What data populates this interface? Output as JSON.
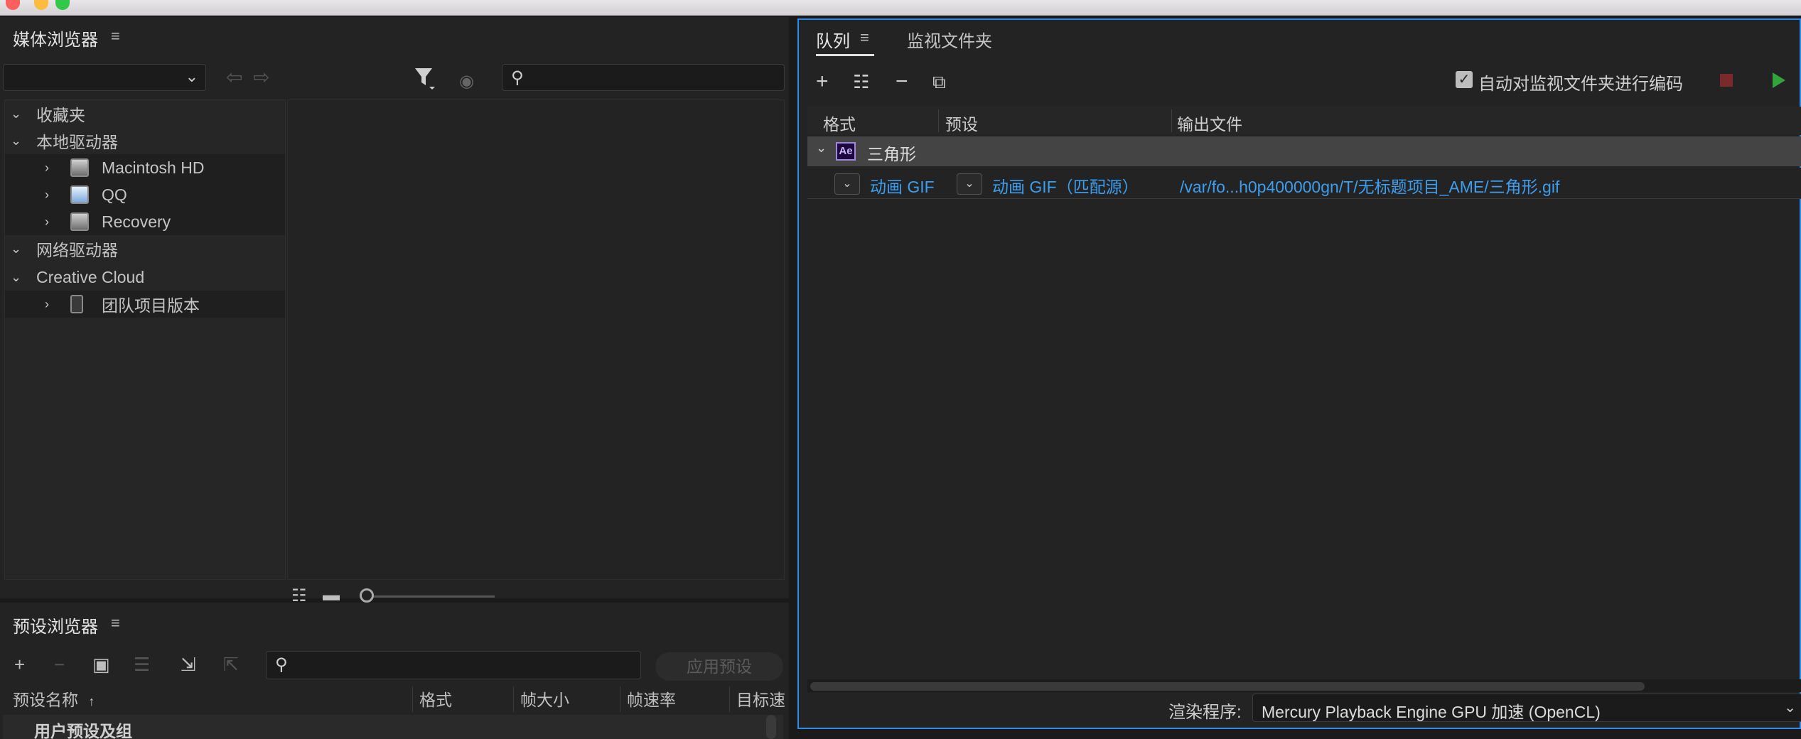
{
  "media_browser": {
    "title": "媒体浏览器",
    "menu_glyph": "≡",
    "tree": [
      {
        "label": "收藏夹",
        "level": 0,
        "expanded": true
      },
      {
        "label": "本地驱动器",
        "level": 0,
        "expanded": true
      },
      {
        "label": "Macintosh HD",
        "level": 1,
        "icon": "hard-drive-icon"
      },
      {
        "label": "QQ",
        "level": 1,
        "icon": "external-drive-icon"
      },
      {
        "label": "Recovery",
        "level": 1,
        "icon": "hard-drive-icon"
      },
      {
        "label": "网络驱动器",
        "level": 0,
        "expanded": true
      },
      {
        "label": "Creative Cloud",
        "level": 0,
        "expanded": true
      },
      {
        "label": "团队项目版本",
        "level": 1,
        "icon": "team-projects-icon"
      }
    ]
  },
  "preset_browser": {
    "title": "预设浏览器",
    "menu_glyph": "≡",
    "apply_button": "应用预设",
    "columns": [
      "预设名称",
      "格式",
      "帧大小",
      "帧速率",
      "目标速"
    ],
    "sort_indicator": "↑",
    "group_label": "用户预设及组"
  },
  "queue": {
    "tabs": [
      "队列",
      "监视文件夹"
    ],
    "menu_glyph": "≡",
    "auto_encode_label": "自动对监视文件夹进行编码",
    "auto_encode_checked": true,
    "columns": [
      "格式",
      "预设",
      "输出文件"
    ],
    "group": {
      "icon_text": "Ae",
      "label": "三角形"
    },
    "item": {
      "format": "动画 GIF",
      "preset": "动画 GIF（匹配源）",
      "output": "/var/fo...h0p400000gn/T/无标题项目_AME/三角形.gif"
    },
    "renderer_label": "渲染程序:",
    "renderer_value": "Mercury Playback Engine GPU 加速 (OpenCL)"
  },
  "colors": {
    "accent_blue": "#2d8ceb",
    "link_blue": "#3d9ef0",
    "start_green": "#33a33c",
    "stop_red": "#7a2a2a"
  }
}
